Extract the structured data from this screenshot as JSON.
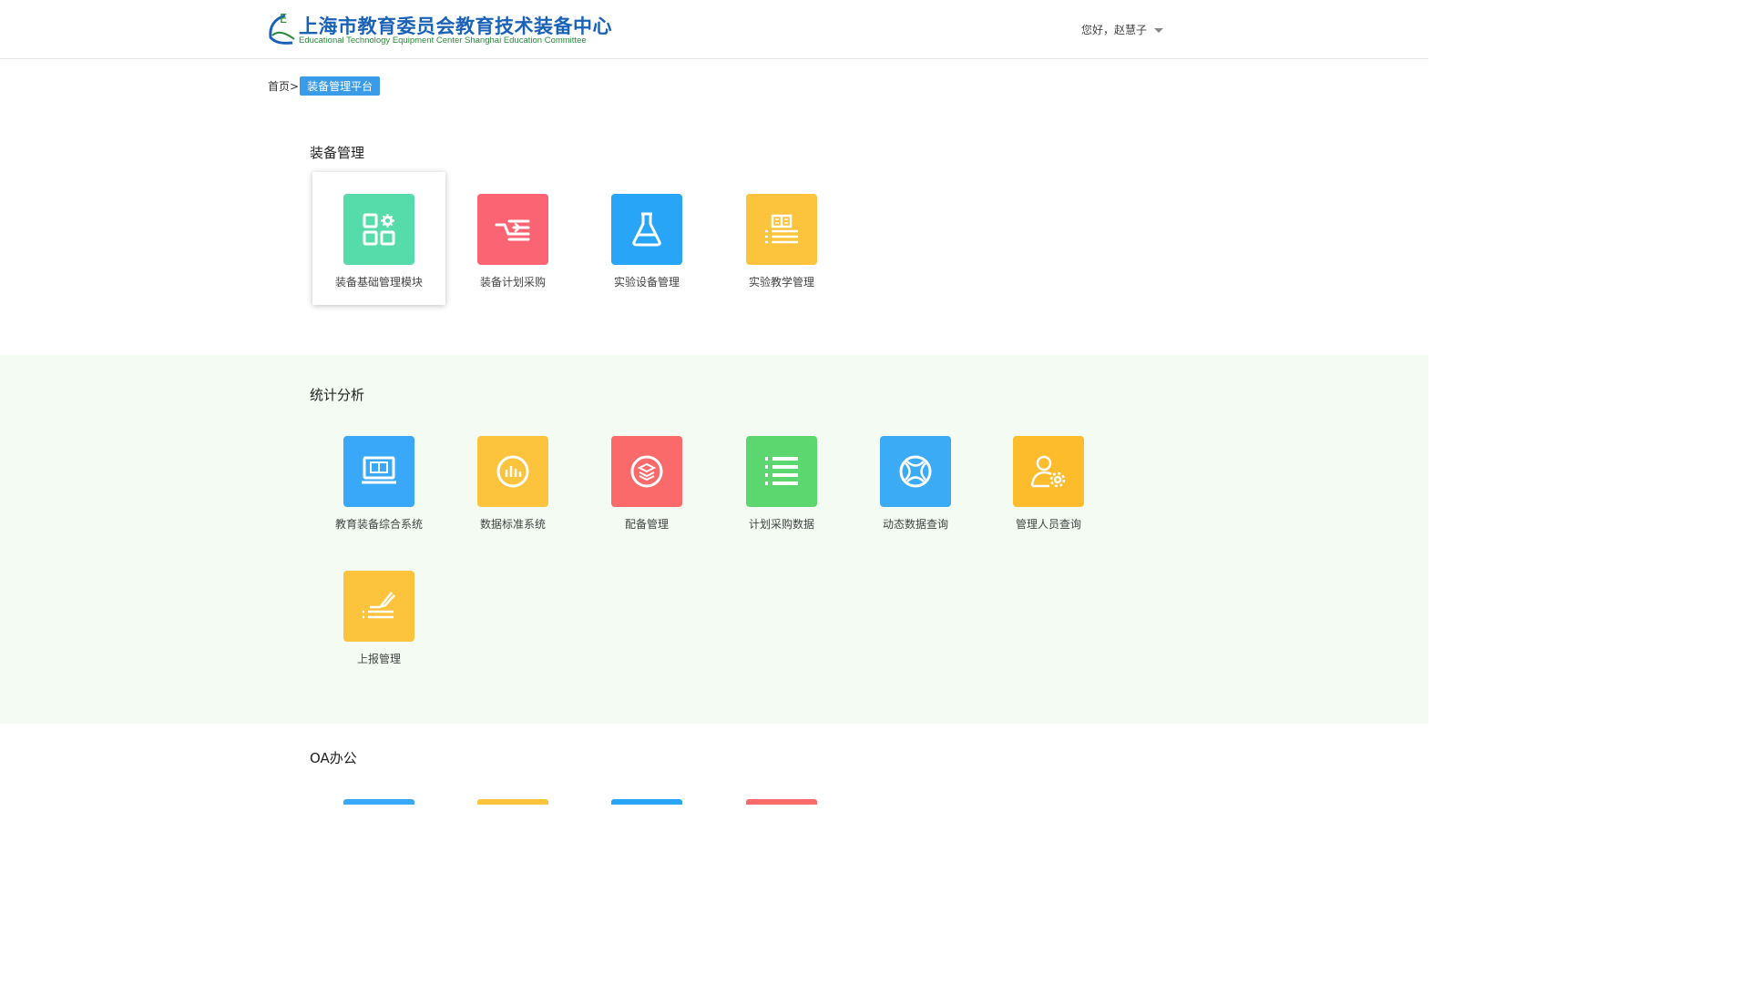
{
  "header": {
    "logo_cn": "上海市教育委员会教育技术装备中心",
    "logo_en": "Educational Technology Equipment Center Shanghai Education Committee",
    "user_greeting": "您好，赵慧子"
  },
  "breadcrumb": {
    "home": "首页>",
    "current": "装备管理平台"
  },
  "sections": {
    "equipment": {
      "title": "装备管理",
      "items": [
        {
          "label": "装备基础管理模块",
          "icon": "apps-gear-icon",
          "color": "#55dcaa"
        },
        {
          "label": "装备计划采购",
          "icon": "purchase-plan-icon",
          "color": "#fb6473"
        },
        {
          "label": "实验设备管理",
          "icon": "flask-icon",
          "color": "#29a5f8"
        },
        {
          "label": "实验教学管理",
          "icon": "book-list-icon",
          "color": "#fcc33c"
        }
      ]
    },
    "stats": {
      "title": "统计分析",
      "items": [
        {
          "label": "教育装备综合系统",
          "icon": "monitor-book-icon",
          "color": "#3aa8f8"
        },
        {
          "label": "数据标准系统",
          "icon": "bar-chart-circle-icon",
          "color": "#fcc33c"
        },
        {
          "label": "配备管理",
          "icon": "layers-circle-icon",
          "color": "#fb6a6a"
        },
        {
          "label": "计划采购数据",
          "icon": "list-icon",
          "color": "#5cd66e"
        },
        {
          "label": "动态数据查询",
          "icon": "dynamic-query-icon",
          "color": "#3cabf5"
        },
        {
          "label": "管理人员查询",
          "icon": "user-gear-icon",
          "color": "#fdbc2c"
        },
        {
          "label": "上报管理",
          "icon": "report-pen-icon",
          "color": "#fcc33c"
        }
      ]
    },
    "oa": {
      "title": "OA办公"
    }
  }
}
